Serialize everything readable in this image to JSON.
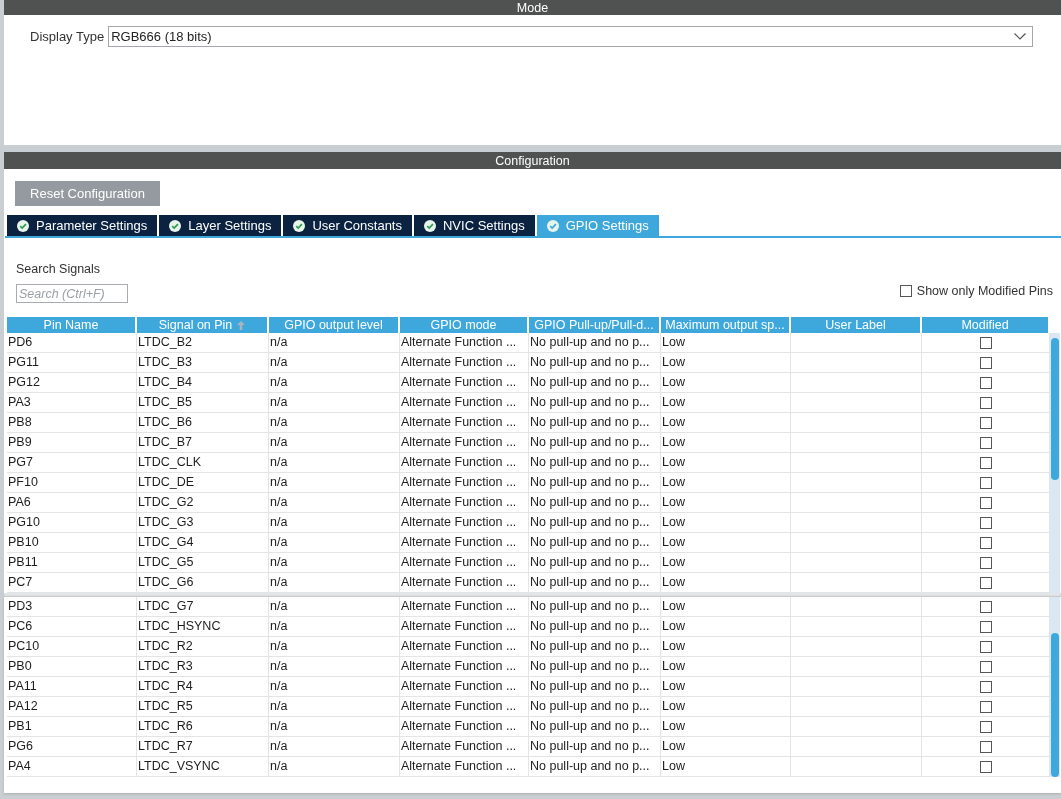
{
  "mode": {
    "title": "Mode",
    "display_type": {
      "label": "Display Type",
      "value": "RGB666 (18 bits)"
    }
  },
  "configuration": {
    "title": "Configuration",
    "reset_button": "Reset Configuration",
    "tabs": [
      {
        "label": "Parameter Settings",
        "selected": false
      },
      {
        "label": "Layer Settings",
        "selected": false
      },
      {
        "label": "User Constants",
        "selected": false
      },
      {
        "label": "NVIC Settings",
        "selected": false
      },
      {
        "label": "GPIO Settings",
        "selected": true
      }
    ],
    "search": {
      "label": "Search Signals",
      "placeholder": "Search (Ctrl+F)"
    },
    "show_modified": {
      "label": "Show only Modified Pins",
      "checked": false
    },
    "table": {
      "columns": [
        {
          "label": "Pin Name",
          "kind": "text",
          "sorted": false
        },
        {
          "label": "Signal on Pin",
          "kind": "text",
          "sorted": true
        },
        {
          "label": "GPIO output level",
          "kind": "text",
          "sorted": false
        },
        {
          "label": "GPIO mode",
          "kind": "text",
          "sorted": false
        },
        {
          "label": "GPIO Pull-up/Pull-d...",
          "kind": "text",
          "sorted": false
        },
        {
          "label": "Maximum output sp...",
          "kind": "text",
          "sorted": false
        },
        {
          "label": "User Label",
          "kind": "text",
          "sorted": false
        },
        {
          "label": "Modified",
          "kind": "checkbox",
          "sorted": false
        }
      ],
      "rows": [
        {
          "cells": [
            "PD6",
            "LTDC_B2",
            "n/a",
            "Alternate Function ...",
            "No pull-up and no p...",
            "Low"
          ],
          "modified": false
        },
        {
          "cells": [
            "PG11",
            "LTDC_B3",
            "n/a",
            "Alternate Function ...",
            "No pull-up and no p...",
            "Low"
          ],
          "modified": false
        },
        {
          "cells": [
            "PG12",
            "LTDC_B4",
            "n/a",
            "Alternate Function ...",
            "No pull-up and no p...",
            "Low"
          ],
          "modified": false
        },
        {
          "cells": [
            "PA3",
            "LTDC_B5",
            "n/a",
            "Alternate Function ...",
            "No pull-up and no p...",
            "Low"
          ],
          "modified": false
        },
        {
          "cells": [
            "PB8",
            "LTDC_B6",
            "n/a",
            "Alternate Function ...",
            "No pull-up and no p...",
            "Low"
          ],
          "modified": false
        },
        {
          "cells": [
            "PB9",
            "LTDC_B7",
            "n/a",
            "Alternate Function ...",
            "No pull-up and no p...",
            "Low"
          ],
          "modified": false
        },
        {
          "cells": [
            "PG7",
            "LTDC_CLK",
            "n/a",
            "Alternate Function ...",
            "No pull-up and no p...",
            "Low"
          ],
          "modified": false
        },
        {
          "cells": [
            "PF10",
            "LTDC_DE",
            "n/a",
            "Alternate Function ...",
            "No pull-up and no p...",
            "Low"
          ],
          "modified": false
        },
        {
          "cells": [
            "PA6",
            "LTDC_G2",
            "n/a",
            "Alternate Function ...",
            "No pull-up and no p...",
            "Low"
          ],
          "modified": false
        },
        {
          "cells": [
            "PG10",
            "LTDC_G3",
            "n/a",
            "Alternate Function ...",
            "No pull-up and no p...",
            "Low"
          ],
          "modified": false
        },
        {
          "cells": [
            "PB10",
            "LTDC_G4",
            "n/a",
            "Alternate Function ...",
            "No pull-up and no p...",
            "Low"
          ],
          "modified": false
        },
        {
          "cells": [
            "PB11",
            "LTDC_G5",
            "n/a",
            "Alternate Function ...",
            "No pull-up and no p...",
            "Low"
          ],
          "modified": false
        },
        {
          "cells": [
            "PC7",
            "LTDC_G6",
            "n/a",
            "Alternate Function ...",
            "No pull-up and no p...",
            "Low"
          ],
          "modified": false
        }
      ]
    },
    "table_lower": {
      "rows": [
        {
          "cells": [
            "PD3",
            "LTDC_G7",
            "n/a",
            "Alternate Function ...",
            "No pull-up and no p...",
            "Low"
          ],
          "modified": false
        },
        {
          "cells": [
            "PC6",
            "LTDC_HSYNC",
            "n/a",
            "Alternate Function ...",
            "No pull-up and no p...",
            "Low"
          ],
          "modified": false
        },
        {
          "cells": [
            "PC10",
            "LTDC_R2",
            "n/a",
            "Alternate Function ...",
            "No pull-up and no p...",
            "Low"
          ],
          "modified": false
        },
        {
          "cells": [
            "PB0",
            "LTDC_R3",
            "n/a",
            "Alternate Function ...",
            "No pull-up and no p...",
            "Low"
          ],
          "modified": false
        },
        {
          "cells": [
            "PA11",
            "LTDC_R4",
            "n/a",
            "Alternate Function ...",
            "No pull-up and no p...",
            "Low"
          ],
          "modified": false
        },
        {
          "cells": [
            "PA12",
            "LTDC_R5",
            "n/a",
            "Alternate Function ...",
            "No pull-up and no p...",
            "Low"
          ],
          "modified": false
        },
        {
          "cells": [
            "PB1",
            "LTDC_R6",
            "n/a",
            "Alternate Function ...",
            "No pull-up and no p...",
            "Low"
          ],
          "modified": false
        },
        {
          "cells": [
            "PG6",
            "LTDC_R7",
            "n/a",
            "Alternate Function ...",
            "No pull-up and no p...",
            "Low"
          ],
          "modified": false
        },
        {
          "cells": [
            "PA4",
            "LTDC_VSYNC",
            "n/a",
            "Alternate Function ...",
            "No pull-up and no p...",
            "Low"
          ],
          "modified": false
        }
      ]
    }
  }
}
